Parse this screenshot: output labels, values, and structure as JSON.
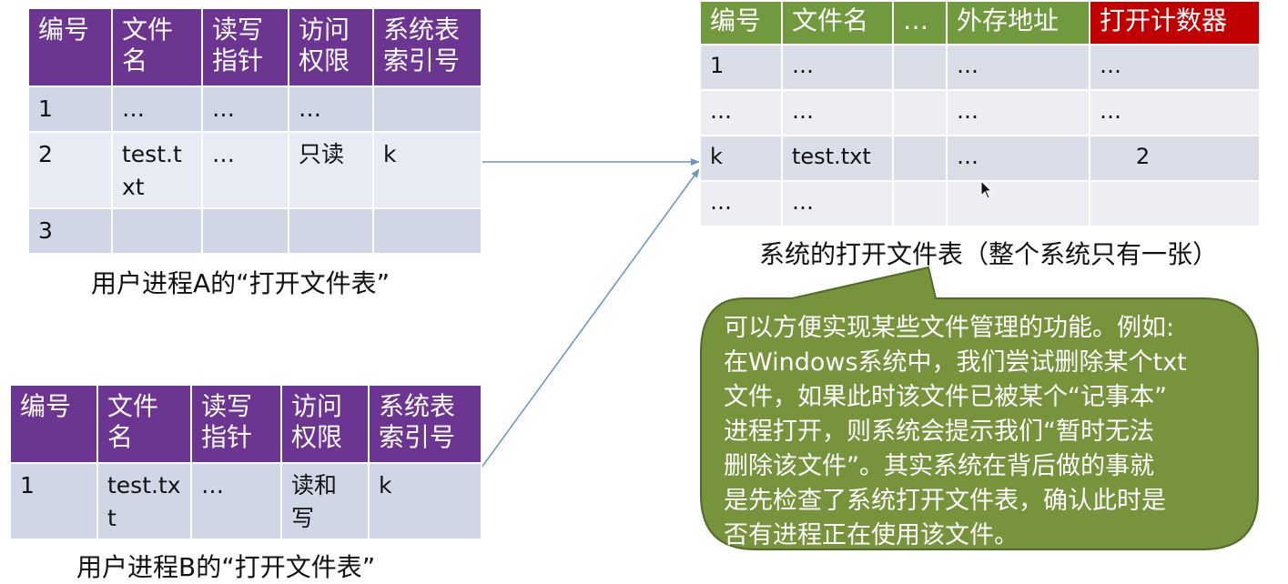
{
  "headers": {
    "num": "编号",
    "fname_l1": "文件",
    "fname_l2": "名",
    "rwptr_l1": "读写",
    "rwptr_l2": "指针",
    "access_l1": "访问",
    "access_l2": "权限",
    "sysidx_l1": "系统表",
    "sysidx_l2": "索引号"
  },
  "table_a": {
    "caption": "用户进程A的“打开文件表”",
    "rows": [
      {
        "num": "1",
        "name": "…",
        "ptr": "…",
        "access": "…",
        "index": ""
      },
      {
        "num": "2",
        "name_l1": "test.t",
        "name_l2": "xt",
        "ptr": "…",
        "access": "只读",
        "index": "k"
      },
      {
        "num": "3",
        "name": "",
        "ptr": "",
        "access": "",
        "index": ""
      }
    ]
  },
  "table_b": {
    "caption": "用户进程B的“打开文件表”",
    "rows": [
      {
        "num": "1",
        "name_l1": "test.tx",
        "name_l2": "t",
        "ptr": "…",
        "access_l1": "读和",
        "access_l2": "写",
        "index": "k"
      }
    ]
  },
  "system_table": {
    "caption": "系统的打开文件表（整个系统只有一张）",
    "headers": [
      "编号",
      "文件名",
      "…",
      "外存地址",
      "打开计数器"
    ],
    "rows": [
      [
        "1",
        "…",
        "",
        "…",
        "…"
      ],
      [
        "…",
        "…",
        "",
        "…",
        "…"
      ],
      [
        "k",
        "test.txt",
        "",
        "…",
        "2"
      ],
      [
        "…",
        "…",
        "",
        "",
        ""
      ]
    ]
  },
  "callout": {
    "lines": [
      "可以方便实现某些文件管理的功能。例如:",
      "在Windows系统中，我们尝试删除某个txt",
      "文件，如果此时该文件已被某个“记事本”",
      "进程打开，则系统会提示我们“暂时无法",
      "删除该文件”。其实系统在背后做的事就",
      "是先检查了系统打开文件表，确认此时是",
      "否有进程正在使用该文件。"
    ]
  },
  "colors": {
    "process_header": "#6b3591",
    "system_header": "#71993e",
    "counter_header": "#c00000",
    "callout_fill": "#77933c",
    "arrow": "#6f97c4"
  }
}
